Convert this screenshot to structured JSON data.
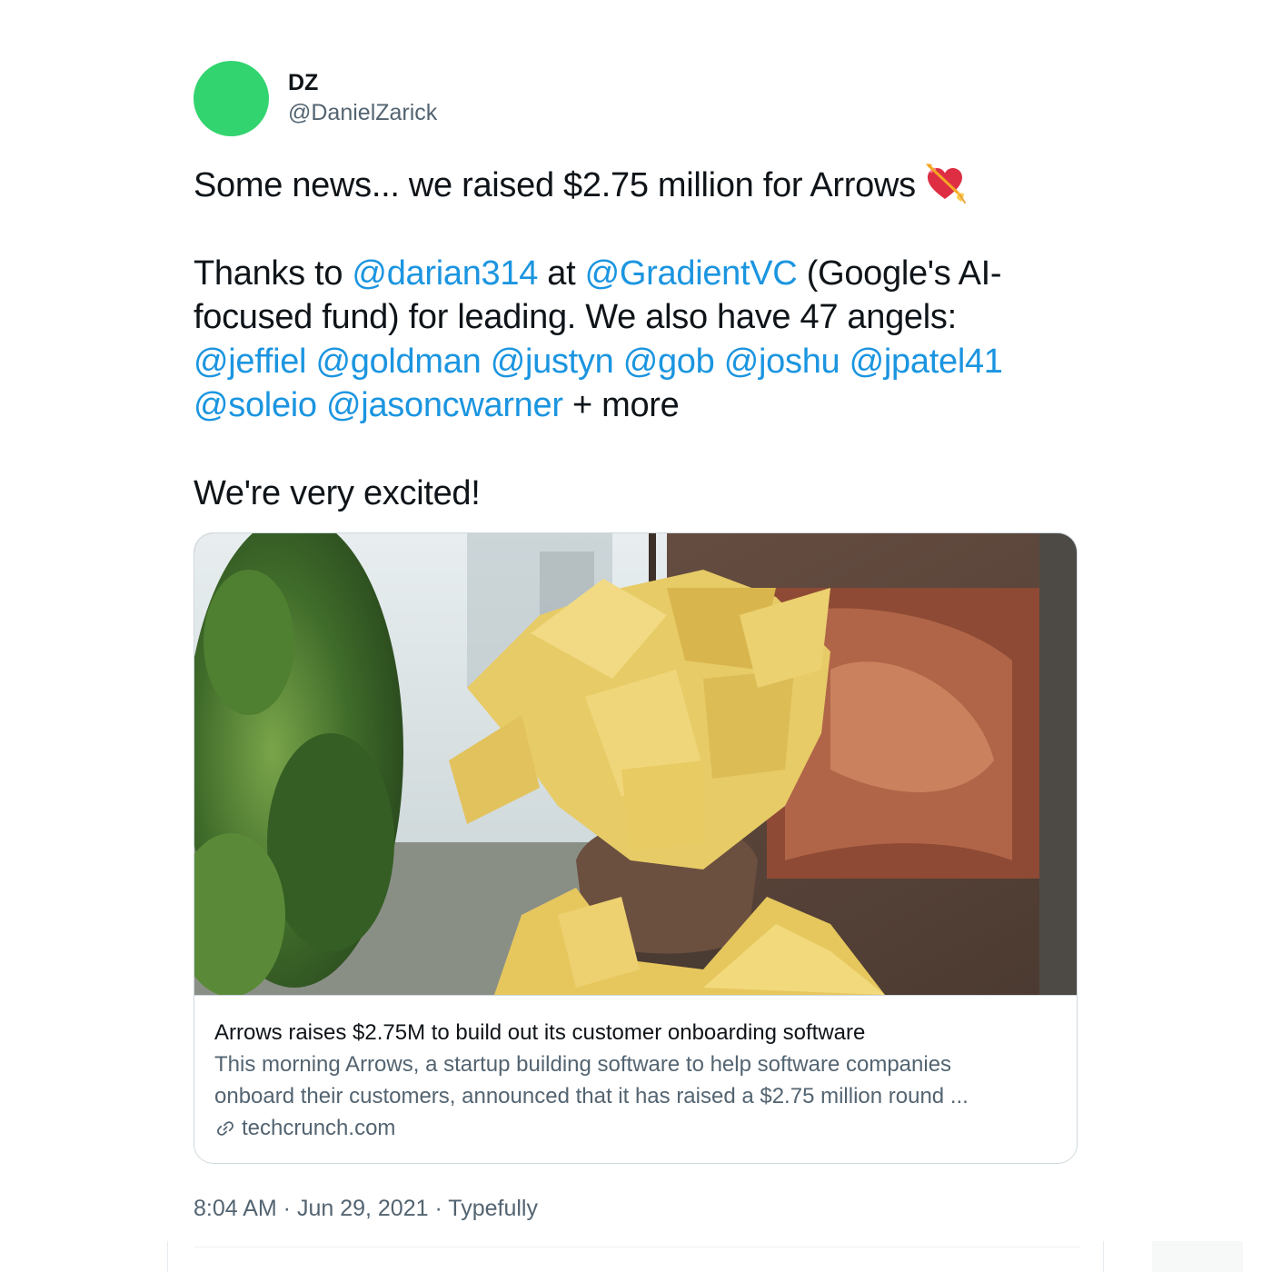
{
  "author": {
    "display_name": "DZ",
    "handle": "@DanielZarick",
    "avatar_color": "#32d46f"
  },
  "tweet": {
    "line1": "Some news... we raised $2.75 million for Arrows",
    "emoji": "heart-with-arrow-icon",
    "p2_thanks": "Thanks to ",
    "p2_mention1": "@darian314",
    "p2_at": " at ",
    "p2_mention2": "@GradientVC",
    "p2_rest_line1": " (Google's AI-",
    "p2_rest_line2": "focused fund) for leading. We also have 47 angels:",
    "angels": [
      "@jeffiel",
      "@goldman",
      "@justyn",
      "@gob",
      "@joshu",
      "@jpatel41",
      "@soleio",
      "@jasoncwarner"
    ],
    "more": " + more",
    "closing": "We're very excited!"
  },
  "card": {
    "image_description": "person-covered-in-sticky-notes",
    "title": "Arrows raises $2.75M to build out its customer onboarding software",
    "description_line1": "This morning Arrows, a startup building software to help software companies",
    "description_line2": "onboard their customers, announced that it has raised a $2.75 million round ...",
    "domain": "techcrunch.com",
    "link_icon": "link-icon"
  },
  "meta": {
    "time": "8:04 AM",
    "date": "Jun 29, 2021",
    "source": "Typefully",
    "separator": " · "
  },
  "colors": {
    "mention": "#1b95e0",
    "secondary_text": "#536471",
    "border": "#cfd9de"
  }
}
